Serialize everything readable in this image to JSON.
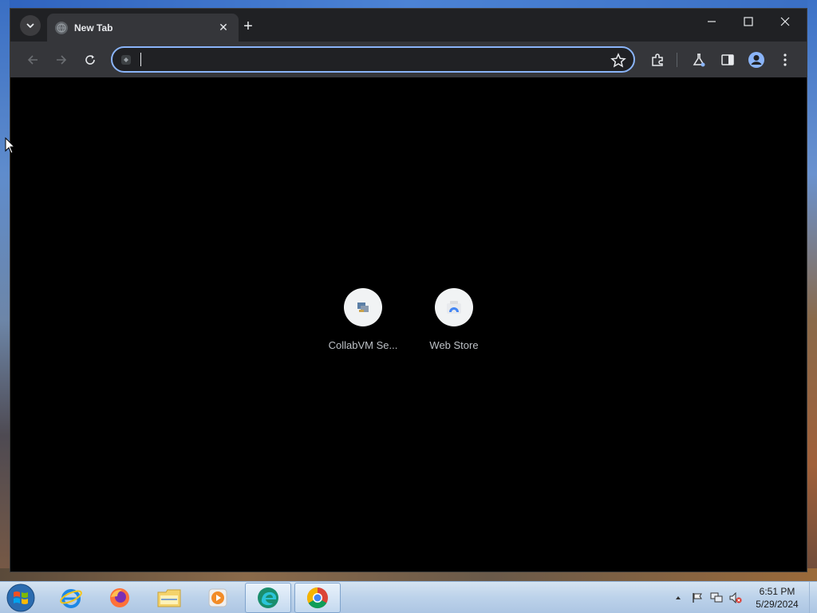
{
  "browser": {
    "tab": {
      "title": "New Tab",
      "close_glyph": "✕"
    },
    "new_tab_glyph": "+",
    "window_controls": {
      "minimize": "minimize-icon",
      "maximize": "maximize-icon",
      "close": "close-icon"
    },
    "omnibox": {
      "value": "",
      "placeholder": ""
    },
    "shortcuts": [
      {
        "label": "CollabVM Se...",
        "icon": "collabvm-icon"
      },
      {
        "label": "Web Store",
        "icon": "web-store-icon"
      }
    ],
    "colors": {
      "accent": "#8ab4f8",
      "frame": "#202124",
      "toolbar": "#35363a",
      "page_bg": "#000000"
    }
  },
  "taskbar": {
    "apps": [
      {
        "name": "internet-explorer-icon"
      },
      {
        "name": "firefox-icon"
      },
      {
        "name": "file-explorer-icon"
      },
      {
        "name": "media-player-icon"
      },
      {
        "name": "edge-icon"
      },
      {
        "name": "chrome-icon"
      }
    ],
    "clock": {
      "time": "6:51 PM",
      "date": "5/29/2024"
    }
  }
}
